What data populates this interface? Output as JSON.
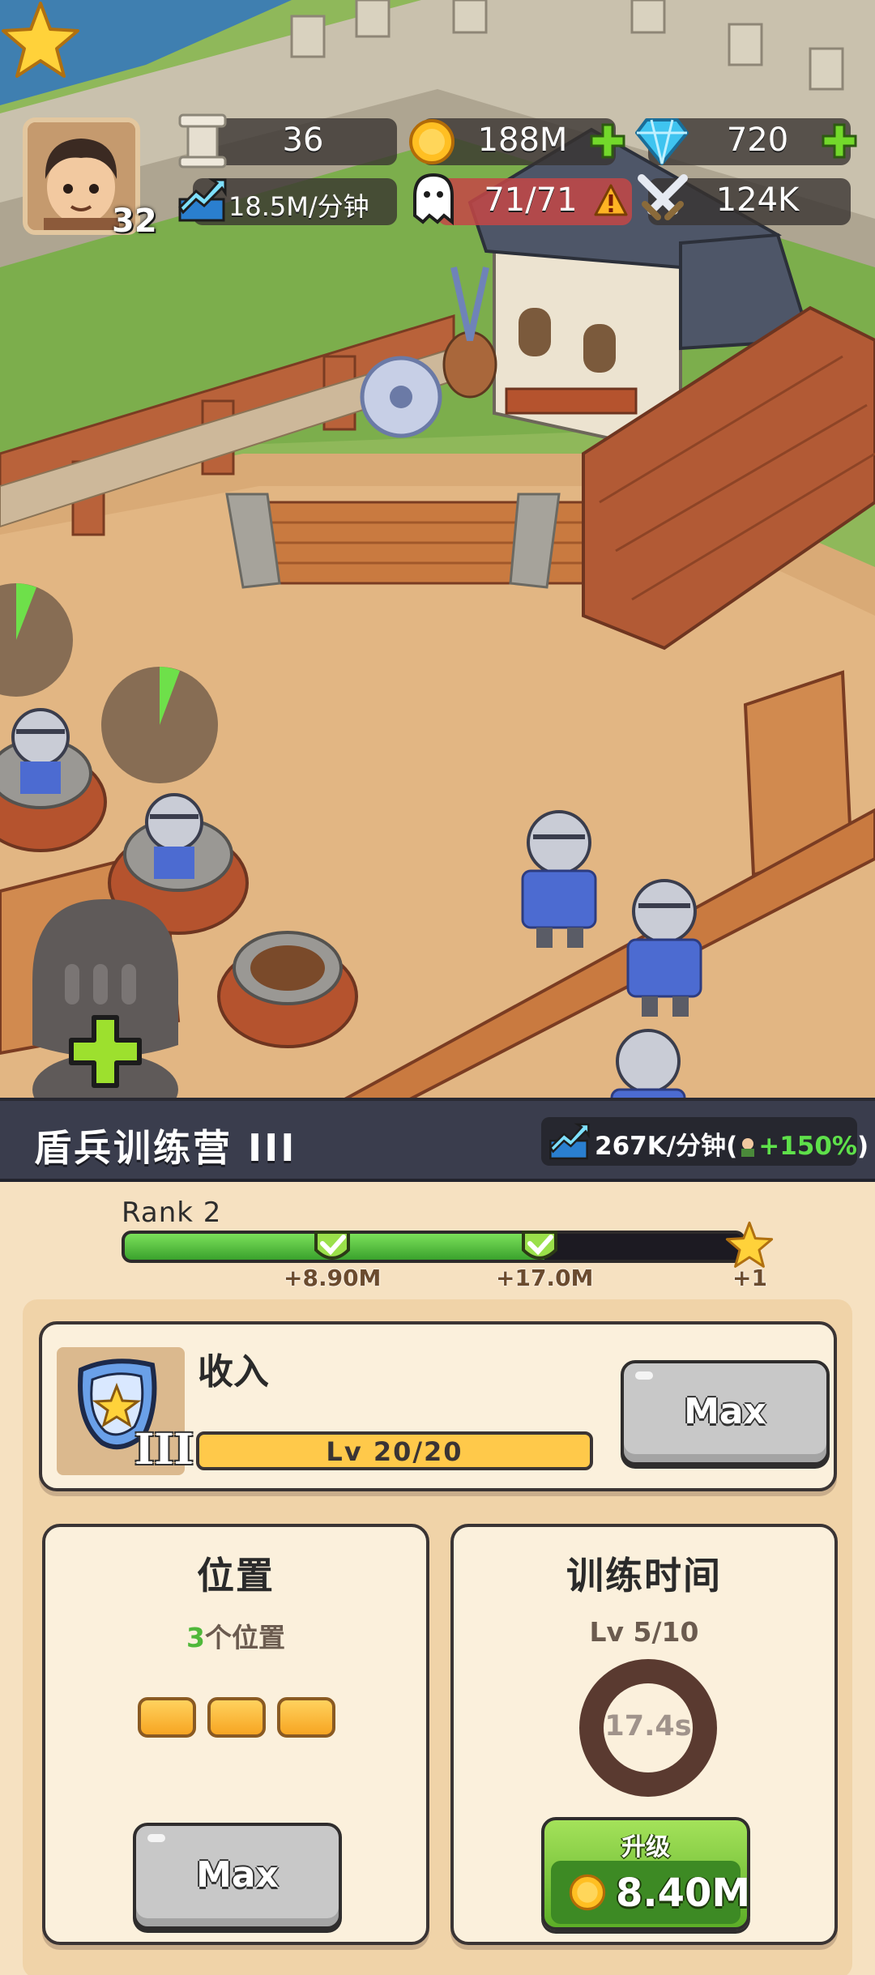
{
  "hud": {
    "level": "32",
    "pillars": "36",
    "gold": "188M",
    "gems": "720",
    "income_rate": "18.5M/分钟",
    "population": "71/71",
    "power": "124K"
  },
  "panel": {
    "title": "盾兵训练营 III",
    "rate": "267K/分钟",
    "rate_bonus": "+150%",
    "rank_label": "Rank 2",
    "rank_progress": 0.68,
    "milestones": [
      {
        "label": "+8.90M",
        "reached": true
      },
      {
        "label": "+17.0M",
        "reached": true
      },
      {
        "label": "+1",
        "reached": false
      }
    ]
  },
  "income": {
    "title": "收入",
    "level": "Lv 20/20",
    "level_fraction": 1.0,
    "badge_roman": "III",
    "button_label": "Max"
  },
  "slots": {
    "title": "位置",
    "count": "3",
    "count_suffix": "个位置",
    "filled": 3,
    "button_label": "Max"
  },
  "training": {
    "title": "训练时间",
    "level": "Lv 5/10",
    "time": "17.4s",
    "upgrade_label": "升级",
    "upgrade_price": "8.40M"
  },
  "colors": {
    "progress_green": "#3aa22d",
    "gold": "#ffc94a",
    "panel_bg": "#f6e1c1",
    "header_bg": "#3a3d4d",
    "bonus_green": "#5ee04a"
  }
}
